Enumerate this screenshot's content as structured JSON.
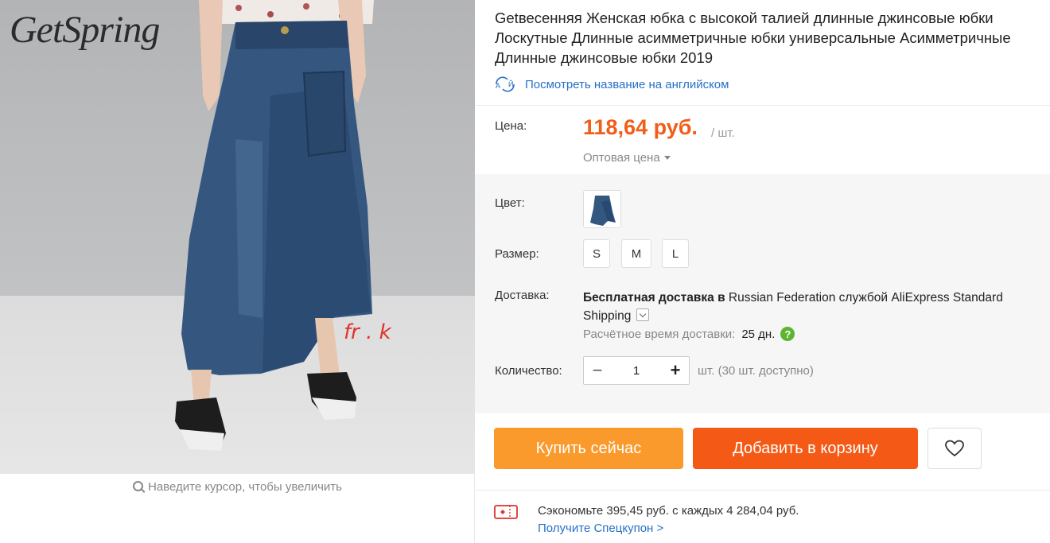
{
  "gallery": {
    "brand": "GetSpring",
    "watermark": "fr . k",
    "zoom_hint": "Наведите курсор, чтобы увеличить"
  },
  "product": {
    "title": "Getвесенняя Женская юбка с высокой талией длинные джинсовые юбки Лоскутные Длинные асимметричные юбки универсальные Асимметричные Длинные джинсовые юбки 2019",
    "translate_link": "Посмотреть название на английском",
    "translate_icon": "translate-icon"
  },
  "price": {
    "label": "Цена:",
    "value": "118,64 руб.",
    "unit": "/ шт.",
    "wholesale": "Оптовая цена",
    "accent": "#f25d18"
  },
  "color": {
    "label": "Цвет:"
  },
  "size": {
    "label": "Размер:",
    "options": [
      "S",
      "M",
      "L"
    ]
  },
  "shipping": {
    "label": "Доставка:",
    "free": "Бесплатная доставка в",
    "destination": "Russian Federation",
    "via": "службой",
    "carrier": "AliExpress Standard Shipping",
    "eta_label": "Расчётное время доставки:",
    "eta_value": "25 дн.",
    "help": "?"
  },
  "quantity": {
    "label": "Количество:",
    "minus": "−",
    "value": "1",
    "plus": "+",
    "available": "шт. (30 шт. доступно)"
  },
  "actions": {
    "buy_now": "Купить сейчас",
    "add_to_cart": "Добавить в корзину",
    "wishlist_icon": "heart-icon",
    "buy_color": "#fb9a2c",
    "cart_color": "#f45a16"
  },
  "coupon": {
    "saving": "Сэкономьте 395,45 руб. с каждых 4 284,04 руб.",
    "link": "Получите Спецкупон >"
  }
}
